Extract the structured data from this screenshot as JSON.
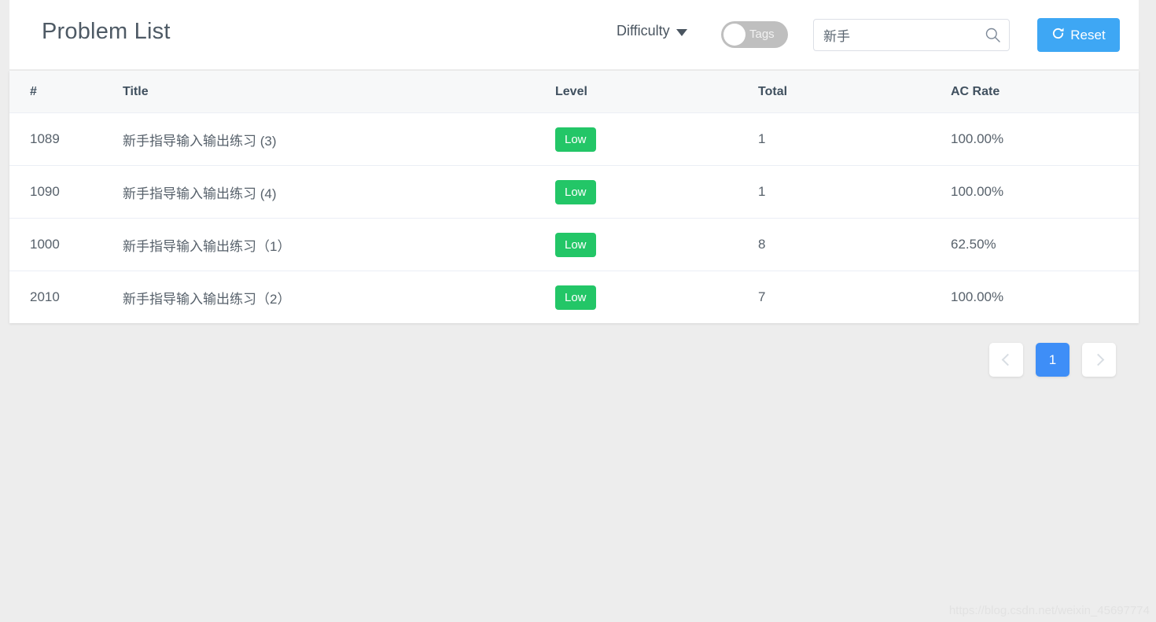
{
  "header": {
    "title": "Problem List",
    "difficulty": {
      "label": "Difficulty",
      "caret_icon": "chevron-down-icon"
    },
    "tags_toggle": {
      "label": "Tags",
      "state": "off",
      "track_color": "#bfbfbf",
      "knob_color": "#ffffff"
    },
    "search": {
      "value": "新手",
      "placeholder": "",
      "icon": "search-icon"
    },
    "reset_button": {
      "label": "Reset",
      "icon": "refresh-icon",
      "color": "#3ea7f4"
    }
  },
  "table": {
    "columns": [
      "#",
      "Title",
      "Level",
      "Total",
      "AC Rate"
    ],
    "rows": [
      {
        "id": "1089",
        "title": "新手指导输入输出练习 (3)",
        "level": "Low",
        "total": "1",
        "ac_rate": "100.00%"
      },
      {
        "id": "1090",
        "title": "新手指导输入输出练习 (4)",
        "level": "Low",
        "total": "1",
        "ac_rate": "100.00%"
      },
      {
        "id": "1000",
        "title": "新手指导输入输出练习（1）",
        "level": "Low",
        "total": "8",
        "ac_rate": "62.50%"
      },
      {
        "id": "2010",
        "title": "新手指导输入输出练习（2）",
        "level": "Low",
        "total": "7",
        "ac_rate": "100.00%"
      }
    ],
    "level_badge_color": "#23c667"
  },
  "pagination": {
    "prev_label": "",
    "current_page": "1",
    "next_label": "",
    "active_color": "#3e8ef7"
  },
  "watermark": "https://blog.csdn.net/weixin_45697774"
}
